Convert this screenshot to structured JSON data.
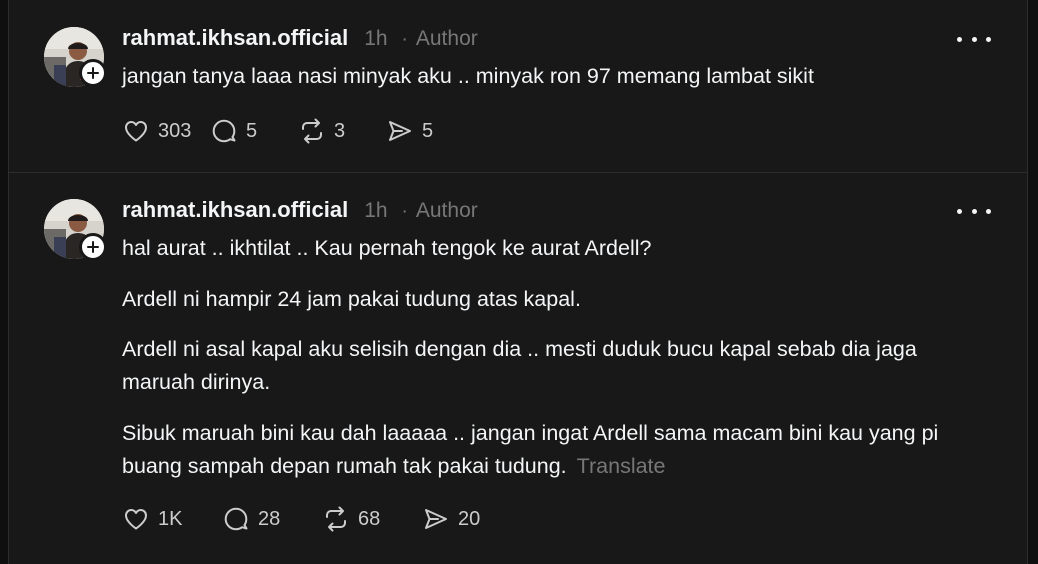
{
  "posts": [
    {
      "username": "rahmat.ikhsan.official",
      "time": "1h",
      "separator": "·",
      "role": "Author",
      "paragraphs": [
        "jangan tanya laaa nasi minyak aku .. minyak ron 97 memang lambat sikit"
      ],
      "likes": "303",
      "comments": "5",
      "reposts": "3",
      "shares": "5"
    },
    {
      "username": "rahmat.ikhsan.official",
      "time": "1h",
      "separator": "·",
      "role": "Author",
      "paragraphs": [
        "hal aurat .. ikhtilat .. Kau pernah tengok ke aurat Ardell?",
        "Ardell ni hampir 24 jam pakai tudung atas kapal.",
        "Ardell ni asal kapal aku selisih dengan dia .. mesti duduk bucu kapal sebab dia jaga maruah dirinya.",
        "Sibuk maruah bini kau dah laaaaa .. jangan ingat Ardell sama macam bini kau yang pi buang sampah depan rumah tak pakai tudung."
      ],
      "translate_label": "Translate",
      "likes": "1K",
      "comments": "28",
      "reposts": "68",
      "shares": "20"
    }
  ],
  "icons": {
    "like": "heart-icon",
    "comment": "comment-bubble-icon",
    "repost": "repost-icon",
    "share": "send-icon",
    "more": "more-horizontal-icon",
    "follow": "plus-icon"
  },
  "colors": {
    "background": "#181818",
    "text": "#f3f5f7",
    "secondary_text": "#777777",
    "divider": "#2d2d2d"
  }
}
